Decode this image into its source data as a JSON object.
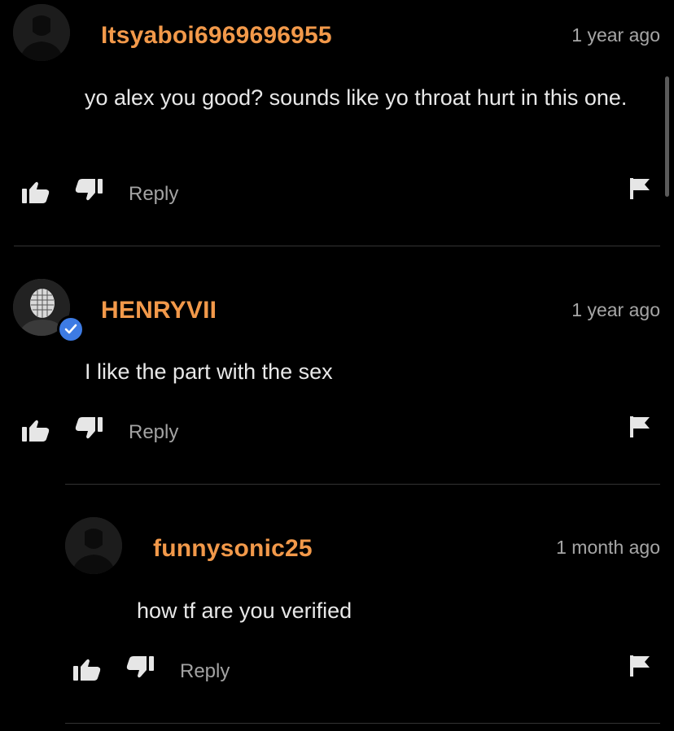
{
  "comments": [
    {
      "username": "Itsyaboi6969696955",
      "timestamp": "1 year ago",
      "text": "yo alex you good? sounds like yo throat hurt in this one.",
      "reply_label": "Reply",
      "verified": false
    },
    {
      "username": "HENRYVII",
      "timestamp": "1 year ago",
      "text": "I like the part with the sex",
      "reply_label": "Reply",
      "verified": true
    },
    {
      "username": "funnysonic25",
      "timestamp": "1 month ago",
      "text": "how tf are you verified",
      "reply_label": "Reply",
      "verified": false
    }
  ],
  "icons": {
    "like": "thumbs-up-icon",
    "dislike": "thumbs-down-icon",
    "flag": "flag-icon",
    "verified": "verified-check-icon",
    "avatar": "default-avatar-icon"
  },
  "colors": {
    "background": "#000000",
    "username": "#f2994a",
    "timestamp": "#a6a6a6",
    "body_text": "#e8e8e8",
    "icon": "#e6e6e6",
    "divider": "#333333",
    "verified_badge": "#3d7be4"
  }
}
